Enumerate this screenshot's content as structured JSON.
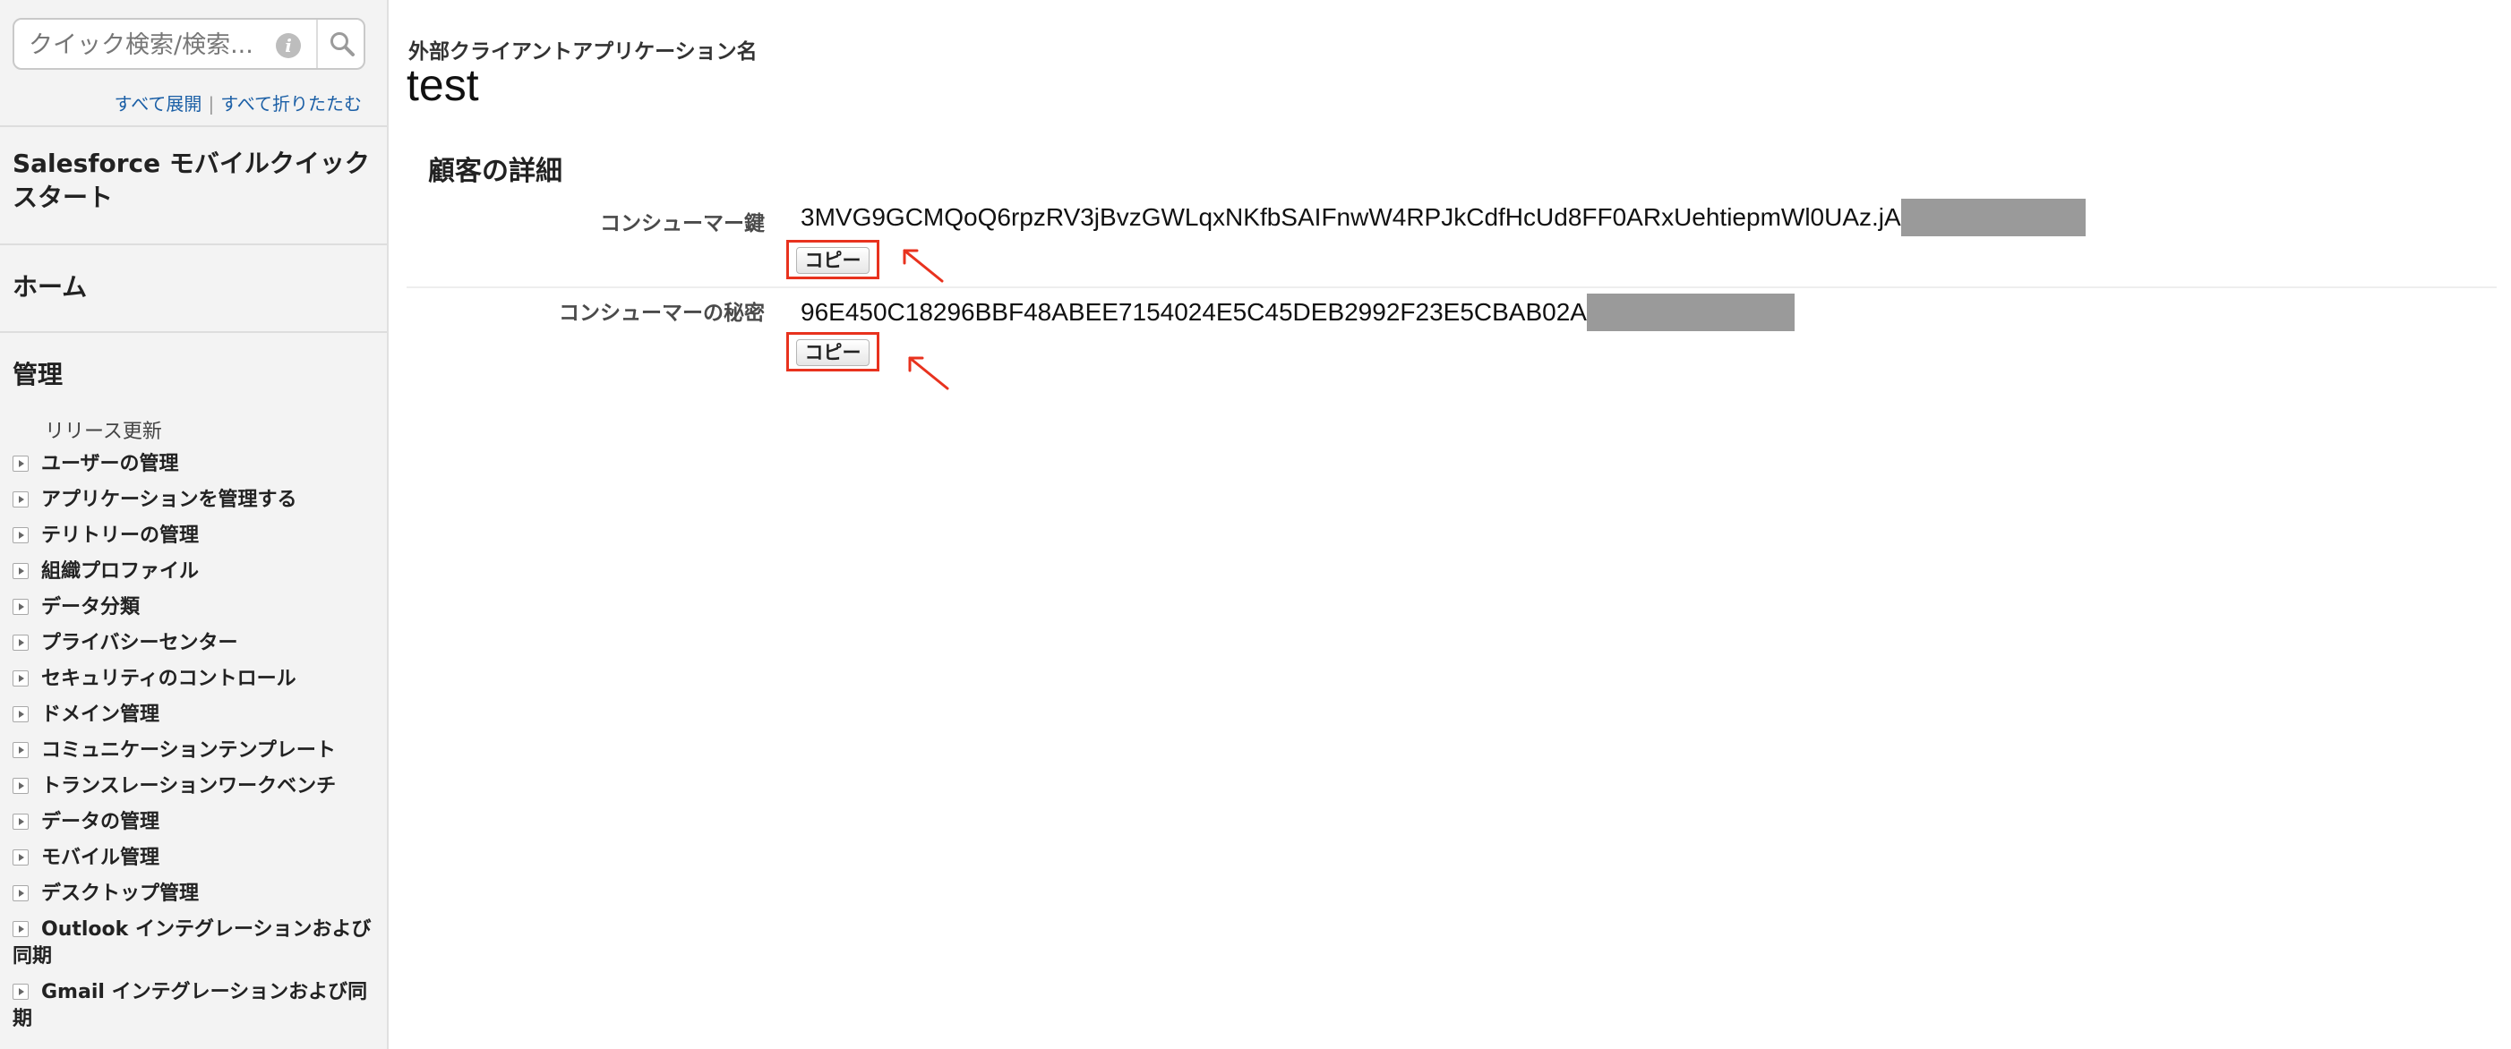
{
  "sidebar": {
    "search": {
      "placeholder": "クイック検索/検索..."
    },
    "expand_all": "すべて展開",
    "separator": "|",
    "collapse_all": "すべて折りたたむ",
    "quickstart_title": "Salesforce モバイルクイックスタート",
    "home_title": "ホーム",
    "admin_title": "管理",
    "release_update": "リリース更新",
    "items": [
      {
        "label": "ユーザーの管理"
      },
      {
        "label": "アプリケーションを管理する"
      },
      {
        "label": "テリトリーの管理"
      },
      {
        "label": "組織プロファイル"
      },
      {
        "label": "データ分類"
      },
      {
        "label": "プライバシーセンター"
      },
      {
        "label": "セキュリティのコントロール"
      },
      {
        "label": "ドメイン管理"
      },
      {
        "label": "コミュニケーションテンプレート"
      },
      {
        "label": "トランスレーションワークベンチ"
      },
      {
        "label": "データの管理"
      },
      {
        "label": "モバイル管理"
      },
      {
        "label": "デスクトップ管理"
      },
      {
        "label": "Outlook インテグレーションおよび同期"
      },
      {
        "label": "Gmail インテグレーションおよび同期"
      }
    ]
  },
  "main": {
    "app_name_label": "外部クライアントアプリケーション名",
    "app_name": "test",
    "section_title": "顧客の詳細",
    "consumer_key": {
      "label": "コンシューマー鍵",
      "value": "3MVG9GCMQoQ6rpzRV3jBvzGWLqxNKfbSAIFnwW4RPJkCdfHcUd8FF0ARxUehtiepmWl0UAz.jA",
      "copy_label": "コピー"
    },
    "consumer_secret": {
      "label": "コンシューマーの秘密",
      "value": "96E450C18296BBF48ABEE7154024E5C45DEB2992F23E5CBAB02A",
      "copy_label": "コピー"
    }
  },
  "colors": {
    "highlight": "#e8321e",
    "link": "#1b5fa6",
    "sidebar_bg": "#f3f3f3",
    "redaction": "#9a9a9a"
  },
  "icons": {
    "search": "search-icon",
    "info": "info-icon",
    "expand": "expand-toggle-icon",
    "annotation": "red-arrow-icon"
  }
}
